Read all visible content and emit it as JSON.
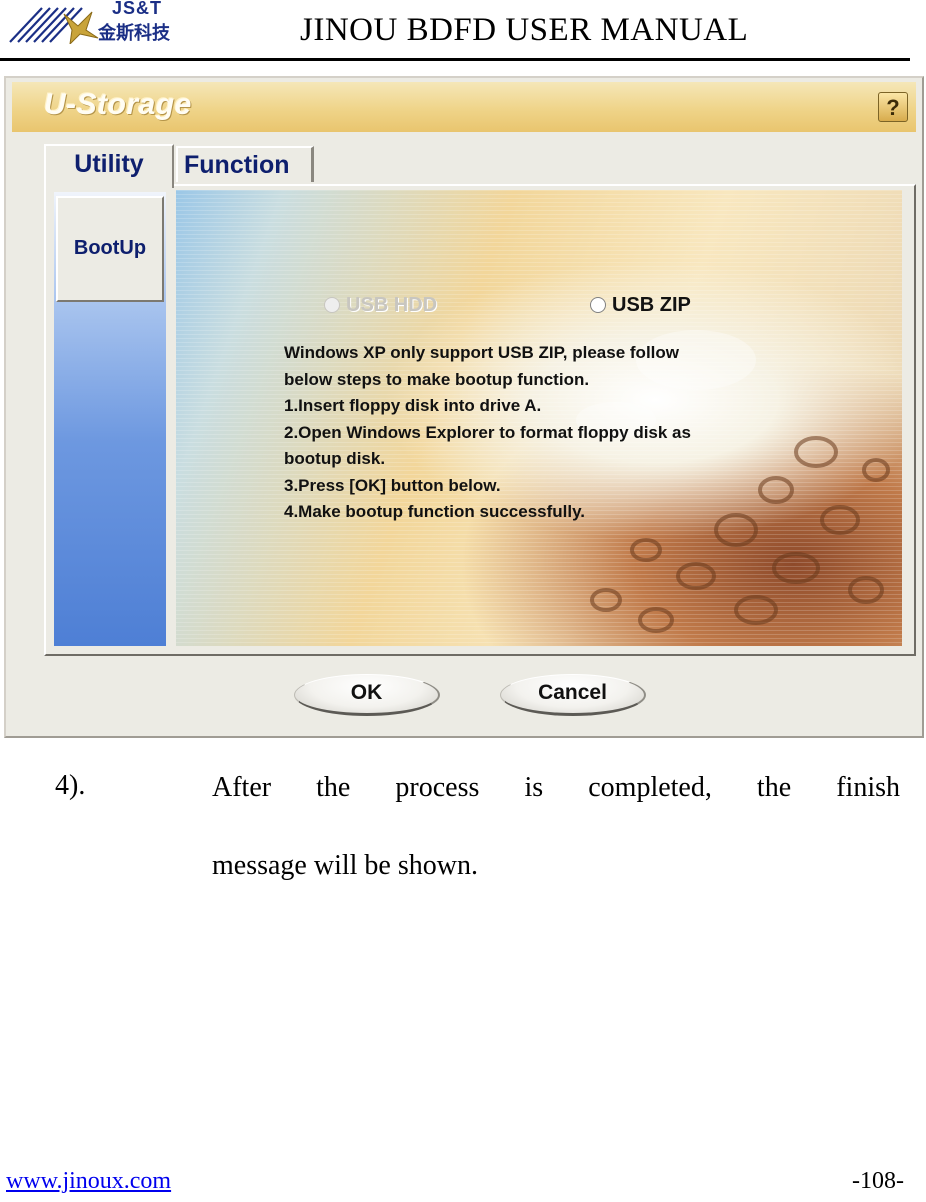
{
  "header": {
    "logo_en": "JS&T",
    "logo_cn": "金斯科技",
    "title": "JINOU BDFD USER MANUAL"
  },
  "screenshot": {
    "app_title": "U-Storage",
    "help_label": "?",
    "tabs": [
      {
        "label": "Utility",
        "selected": true
      },
      {
        "label": "Function",
        "selected": false
      }
    ],
    "sidebar": {
      "items": [
        {
          "label": "BootUp"
        }
      ]
    },
    "options": [
      {
        "label": "USB HDD",
        "enabled": false,
        "selected": false
      },
      {
        "label": "USB ZIP",
        "enabled": true,
        "selected": false
      }
    ],
    "instructions": [
      "Windows XP only support USB ZIP, please follow",
      "below steps to make bootup function.",
      "1.Insert floppy disk into drive A.",
      "2.Open Windows Explorer to format floppy disk as",
      "bootup disk.",
      "3.Press [OK] button below.",
      "4.Make bootup function successfully."
    ],
    "buttons": {
      "ok": "OK",
      "cancel": "Cancel"
    },
    "colors": {
      "title_bar": "#efd489",
      "tab_text": "#0e1f6e",
      "sidebar": "#6d98e0"
    }
  },
  "body": {
    "step_number": "4).",
    "step_line1": "After the process is completed, the finish",
    "step_line2": "message will be shown."
  },
  "footer": {
    "url": "www.jinoux.com",
    "page": "-108-"
  }
}
